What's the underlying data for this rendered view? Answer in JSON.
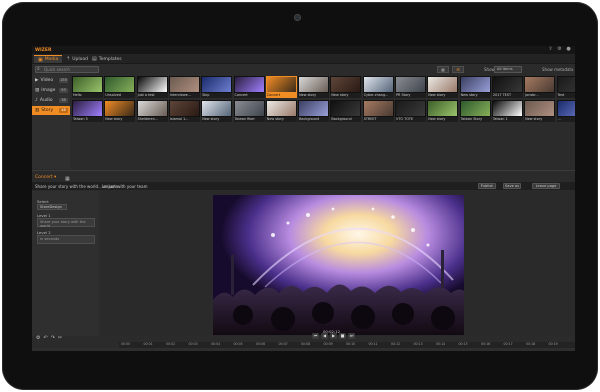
{
  "app": {
    "title": "WIZER"
  },
  "tabs": [
    {
      "label": "Media",
      "icon": "film-icon",
      "active": true
    },
    {
      "label": "Upload",
      "icon": "upload-icon",
      "active": false
    },
    {
      "label": "Templates",
      "icon": "template-icon",
      "active": false
    }
  ],
  "search": {
    "placeholder": "Quick search"
  },
  "toolbar": {
    "show_label": "Show:",
    "show_value": "All items",
    "metadata_label": "Show metadata"
  },
  "categories": [
    {
      "label": "Video",
      "count": "155",
      "icon": "video-icon"
    },
    {
      "label": "Image",
      "count": "93",
      "icon": "image-icon"
    },
    {
      "label": "Audio",
      "count": "38",
      "icon": "audio-icon"
    },
    {
      "label": "Story",
      "count": "48",
      "icon": "story-icon",
      "active": true
    }
  ],
  "thumbnails_row1": [
    "Hello",
    "Unsolved",
    "Just a test",
    "Interviewe...",
    "Skip",
    "Concert",
    "Concert",
    "New story",
    "New story",
    "Cyber-chang...",
    "PR Story",
    "New story",
    "New story",
    "2017 TEST",
    "Jonsbr...",
    "Test"
  ],
  "thumbnails_row2": [
    "Taiwan 5",
    "New story",
    "Shelderen...",
    "Islamol 1...",
    "New story",
    "Taiwan fiber",
    "New story",
    "Background",
    "Background",
    "STREET",
    "VTO TOTE",
    "New story",
    "Taiwan Story",
    "Taiwan 1",
    "New story",
    "..."
  ],
  "selected_thumbnail": "Concert",
  "left_panel": {
    "header": "Concert",
    "grid_icon": "grid-icon"
  },
  "story_bar": {
    "text": "Share your story with the world... or just with your team",
    "section": "Lessons",
    "buttons": [
      "Publish",
      "Save as",
      "Leave page"
    ]
  },
  "props": [
    {
      "label": "Select",
      "type": "select",
      "value": "StoreDesign"
    },
    {
      "label": "Level 1",
      "type": "field",
      "value": "Share your story with the world"
    },
    {
      "label": "Level 2",
      "type": "field",
      "value": "in seconds"
    }
  ],
  "player": {
    "timecode": "00:02:12"
  },
  "ruler_ticks": [
    "00:00",
    "00:01",
    "00:02",
    "00:03",
    "00:04",
    "00:05",
    "00:06",
    "00:07",
    "00:08",
    "00:09",
    "00:10",
    "00:11",
    "00:12",
    "00:13",
    "00:14",
    "00:15",
    "00:16",
    "00:17",
    "00:18",
    "00:19"
  ],
  "colors": {
    "accent": "#f08c24",
    "bg": "#2b2b2b",
    "panel": "#2f2f2f"
  }
}
